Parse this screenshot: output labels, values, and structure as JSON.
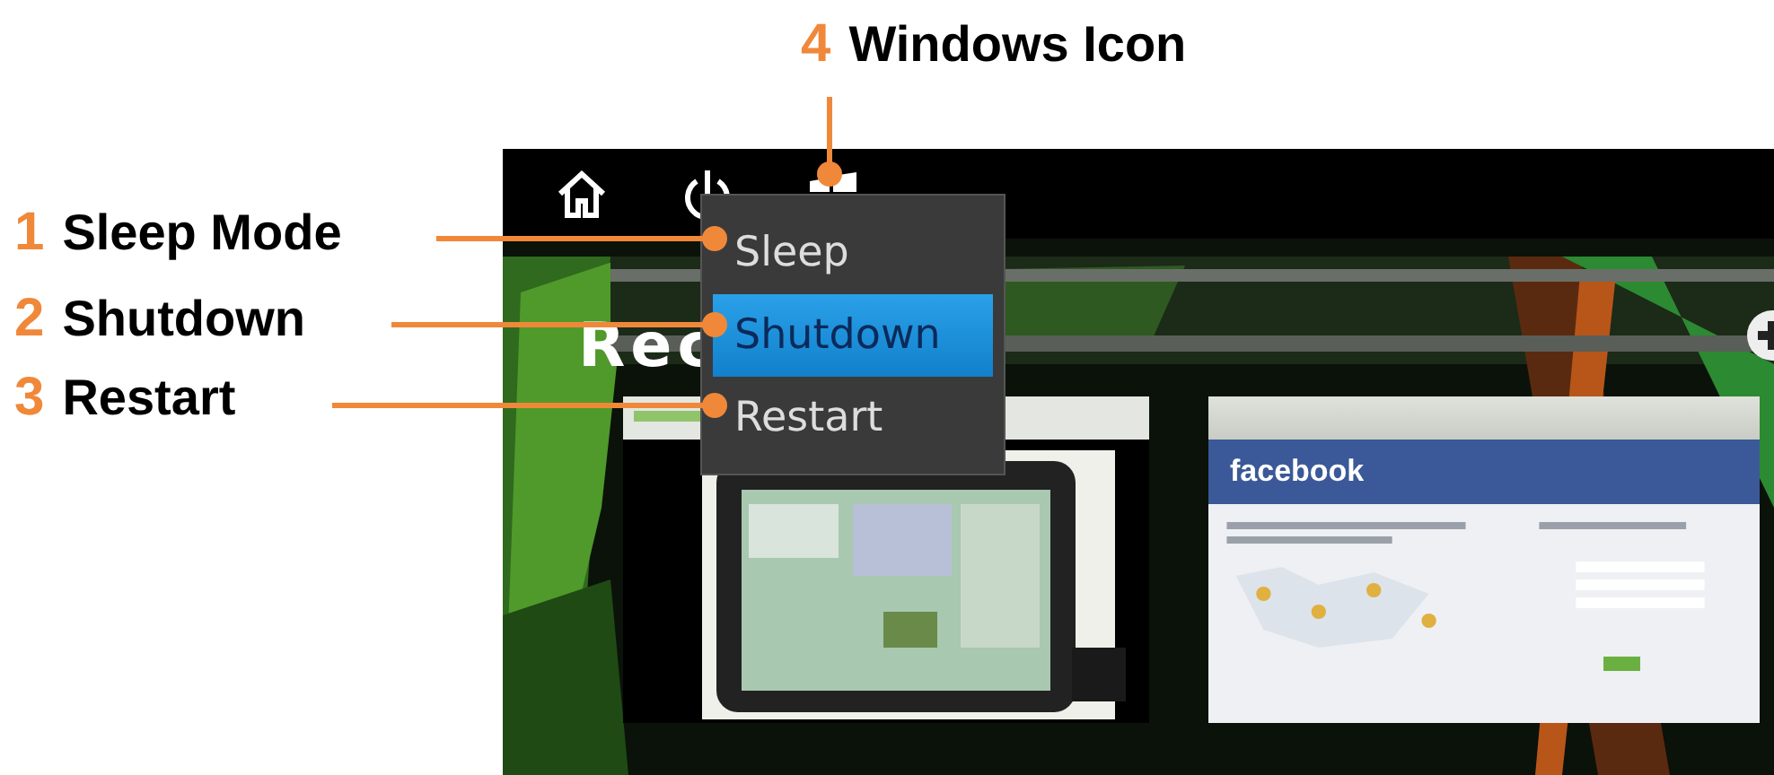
{
  "callouts": [
    {
      "number": "1",
      "label": "Sleep Mode"
    },
    {
      "number": "2",
      "label": "Shutdown"
    },
    {
      "number": "3",
      "label": "Restart"
    },
    {
      "number": "4",
      "label": "Windows Icon"
    }
  ],
  "screen": {
    "section_title": "Rec",
    "power_menu": [
      {
        "label": "Sleep",
        "selected": false
      },
      {
        "label": "Shutdown",
        "selected": true
      },
      {
        "label": "Restart",
        "selected": false
      }
    ],
    "thumbnails": [
      {
        "kind": "tablet"
      },
      {
        "kind": "web",
        "site_name": "facebook"
      }
    ]
  }
}
